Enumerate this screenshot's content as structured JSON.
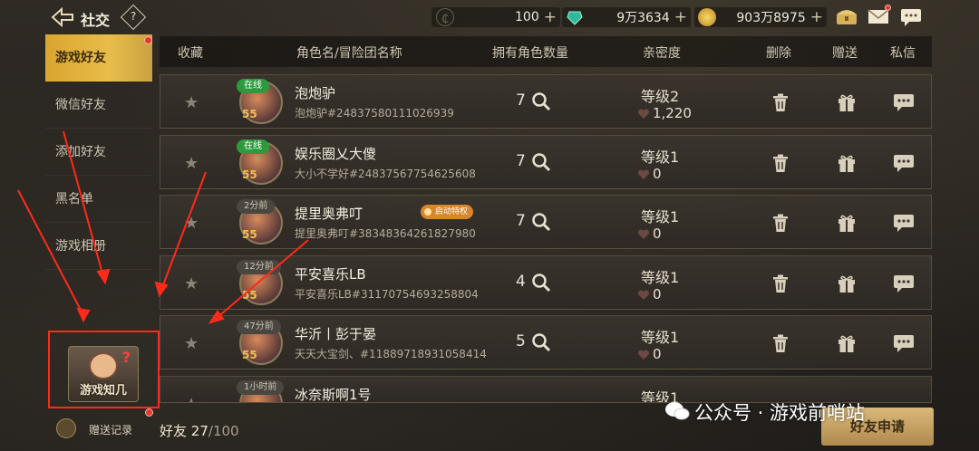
{
  "topbar": {
    "title": "社交",
    "help": "?",
    "currencies": [
      {
        "value": "100",
        "icon": "coin-c-icon"
      },
      {
        "value": "9万3634",
        "icon": "gem-icon"
      },
      {
        "value": "903万8975",
        "icon": "gold-coin-icon"
      }
    ],
    "plus": "+"
  },
  "sidebar": {
    "items": [
      {
        "label": "游戏好友",
        "active": true
      },
      {
        "label": "微信好友"
      },
      {
        "label": "添加好友"
      },
      {
        "label": "黑名单"
      },
      {
        "label": "游戏相册"
      }
    ],
    "zhiji_label": "游戏知几",
    "gift_record": "赠送记录"
  },
  "friend_count": {
    "label": "好友",
    "count": "27",
    "max": "/100"
  },
  "header": {
    "favorite": "收藏",
    "name": "角色名/冒险团名称",
    "roles": "拥有角色数量",
    "intimacy": "亲密度",
    "delete": "删除",
    "gift": "赠送",
    "message": "私信"
  },
  "friends": [
    {
      "status": "在线",
      "online": true,
      "level": "55",
      "name": "泡炮驴",
      "sub": "泡炮驴#24837580111026939",
      "count": "7",
      "intimacy_level": "等级2",
      "intimacy": "1,220"
    },
    {
      "status": "在线",
      "online": true,
      "level": "55",
      "name": "娱乐圈乂大傻",
      "sub": "大小不学好#24837567754625608",
      "count": "7",
      "intimacy_level": "等级1",
      "intimacy": "0"
    },
    {
      "status": "2分前",
      "online": false,
      "level": "55",
      "name": "提里奥弗叮",
      "sub": "提里奥弗叮#38348364261827980",
      "count": "7",
      "intimacy_level": "等级1",
      "intimacy": "0",
      "privilege": "启动特权"
    },
    {
      "status": "12分前",
      "online": false,
      "level": "55",
      "name": "平安喜乐LB",
      "sub": "平安喜乐LB#31170754693258804",
      "count": "4",
      "intimacy_level": "等级1",
      "intimacy": "0"
    },
    {
      "status": "47分前",
      "online": false,
      "level": "55",
      "name": "华沂丨彭于晏",
      "sub": "天天大宝剑、#11889718931058414",
      "count": "5",
      "intimacy_level": "等级1",
      "intimacy": "0"
    },
    {
      "status": "1小时前",
      "online": false,
      "level": "",
      "name": "冰奈斯啊1号",
      "sub": "",
      "count": "",
      "intimacy_level": "等级1",
      "intimacy": ""
    }
  ],
  "apply_button": "好友申请",
  "watermark": "公众号 · 游戏前哨站"
}
